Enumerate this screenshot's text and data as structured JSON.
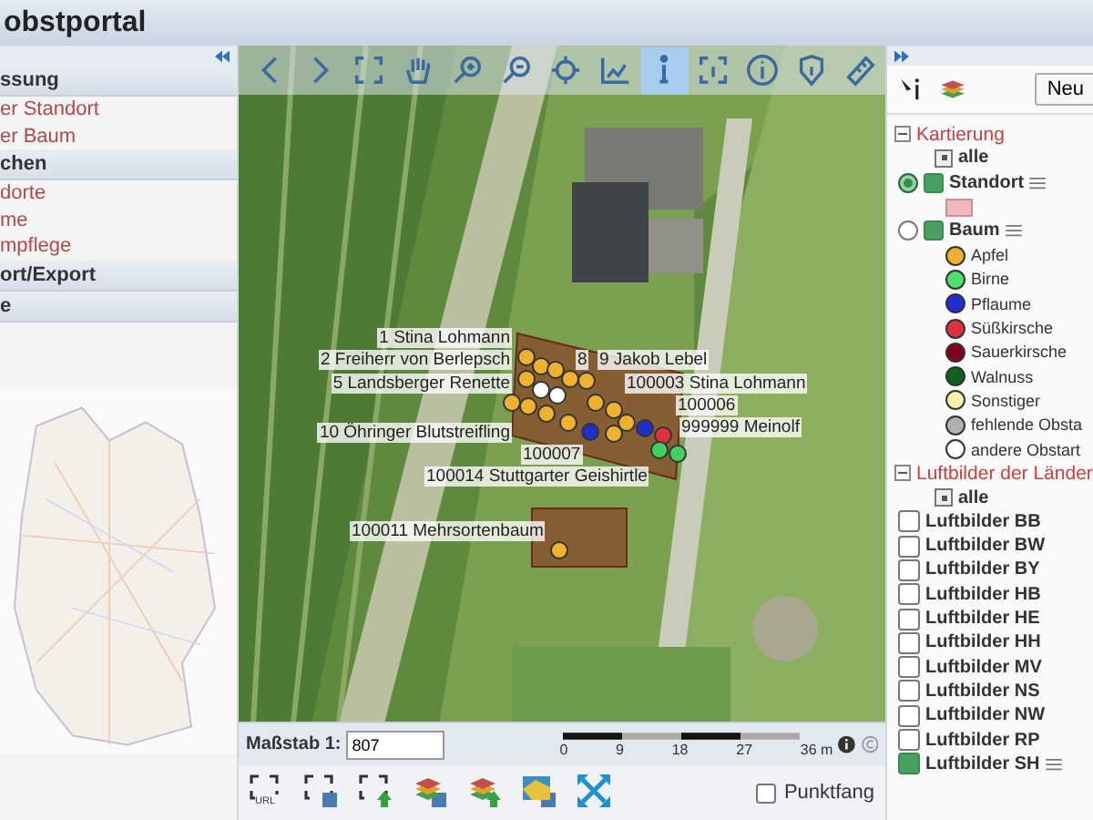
{
  "header": {
    "title": "obstportal"
  },
  "left_panel": {
    "sections": [
      {
        "kind": "header",
        "label": "ssung"
      },
      {
        "kind": "link",
        "label": "er Standort"
      },
      {
        "kind": "link",
        "label": "er Baum"
      },
      {
        "kind": "header",
        "label": "chen"
      },
      {
        "kind": "link",
        "label": "dorte"
      },
      {
        "kind": "link",
        "label": "me"
      },
      {
        "kind": "link",
        "label": "mpflege"
      },
      {
        "kind": "header",
        "label": "ort/Export"
      },
      {
        "kind": "header",
        "label": "e"
      }
    ]
  },
  "map_toolbar": [
    {
      "kind": "back",
      "selected": false
    },
    {
      "kind": "forward",
      "selected": false
    },
    {
      "kind": "frame",
      "selected": false
    },
    {
      "kind": "hand",
      "selected": false
    },
    {
      "kind": "zoom-in",
      "selected": false
    },
    {
      "kind": "zoom-out",
      "selected": false
    },
    {
      "kind": "crosshair",
      "selected": false
    },
    {
      "kind": "chart",
      "selected": false
    },
    {
      "kind": "info",
      "selected": true
    },
    {
      "kind": "frame-info",
      "selected": false
    },
    {
      "kind": "info-circle",
      "selected": false
    },
    {
      "kind": "shield",
      "selected": false
    },
    {
      "kind": "ruler",
      "selected": false
    }
  ],
  "map": {
    "labels": [
      "1 Stina Lohmann",
      "2 Freiherr von Berlepsch",
      "8",
      "9 Jakob Lebel",
      "5 Landsberger Renette",
      "100003 Stina Lohmann",
      "100006",
      "10 Öhringer Blutstreifling",
      "999999 Meinolf",
      "100007",
      "100014 Stuttgarter Geishirtle",
      "100011 Mehrsortenbaum"
    ],
    "markers": [
      {
        "color": "#f0b030"
      },
      {
        "color": "#f0b030"
      },
      {
        "color": "#f0b030"
      },
      {
        "color": "#f0b030"
      },
      {
        "color": "#f0b030"
      },
      {
        "color": "#f0b030"
      },
      {
        "color": "#f0b030"
      },
      {
        "color": "#f0b030"
      },
      {
        "color": "#f0b030"
      },
      {
        "color": "#f0b030"
      },
      {
        "color": "#f0b030"
      },
      {
        "color": "#f0b030"
      },
      {
        "color": "#f0b030"
      },
      {
        "color": "#f0b030"
      },
      {
        "color": "#f0b030"
      },
      {
        "color": "#ffffff"
      },
      {
        "color": "#ffffff"
      },
      {
        "color": "#2030c8"
      },
      {
        "color": "#2030c8"
      },
      {
        "color": "#e03040"
      },
      {
        "color": "#40d060"
      },
      {
        "color": "#40d060"
      }
    ]
  },
  "scale": {
    "label": "Maßstab 1:",
    "value": "807",
    "ticks": [
      "0",
      "9",
      "18",
      "27",
      "36 m"
    ]
  },
  "bottom_toolbar": [
    {
      "kind": "frame-url",
      "label": "URL"
    },
    {
      "kind": "frame-save"
    },
    {
      "kind": "frame-upload"
    },
    {
      "kind": "layers-save"
    },
    {
      "kind": "layers-upload"
    },
    {
      "kind": "map-save"
    },
    {
      "kind": "extent"
    }
  ],
  "snap": {
    "label": "Punktfang",
    "checked": false
  },
  "right_panel": {
    "new_button": "Neu",
    "groups": [
      {
        "label": "Kartierung",
        "expanded": true,
        "all": "alle",
        "layers": [
          {
            "label": "Standort",
            "radio_selected": true,
            "checked": true,
            "legend": [
              {
                "kind": "swatch",
                "color": "#f0b8c0"
              }
            ]
          },
          {
            "label": "Baum",
            "radio_selected": false,
            "checked": true,
            "legend": [
              {
                "kind": "dot",
                "label": "Apfel",
                "color": "#f0b030"
              },
              {
                "kind": "dot",
                "label": "Birne",
                "color": "#50e070"
              },
              {
                "kind": "dot",
                "label": "Pflaume",
                "color": "#2030d0"
              },
              {
                "kind": "dot",
                "label": "Süßkirsche",
                "color": "#e03040"
              },
              {
                "kind": "dot",
                "label": "Sauerkirsche",
                "color": "#800020"
              },
              {
                "kind": "dot",
                "label": "Walnuss",
                "color": "#106020"
              },
              {
                "kind": "dot",
                "label": "Sonstiger",
                "color": "#fff0b0"
              },
              {
                "kind": "dot",
                "label": "fehlende Obsta",
                "color": "#b0b0b0"
              },
              {
                "kind": "dot",
                "label": "andere Obstart",
                "color": "#ffffff"
              }
            ]
          }
        ]
      },
      {
        "label": "Luftbilder der Länder",
        "expanded": true,
        "all": "alle",
        "checks": [
          {
            "label": "Luftbilder BB",
            "checked": false
          },
          {
            "label": "Luftbilder BW",
            "checked": false
          },
          {
            "label": "Luftbilder BY",
            "checked": false
          },
          {
            "label": "Luftbilder HB",
            "checked": false
          },
          {
            "label": "Luftbilder HE",
            "checked": false
          },
          {
            "label": "Luftbilder HH",
            "checked": false
          },
          {
            "label": "Luftbilder MV",
            "checked": false
          },
          {
            "label": "Luftbilder NS",
            "checked": false
          },
          {
            "label": "Luftbilder NW",
            "checked": false
          },
          {
            "label": "Luftbilder RP",
            "checked": false
          },
          {
            "label": "Luftbilder SH",
            "checked": true
          }
        ]
      }
    ]
  }
}
